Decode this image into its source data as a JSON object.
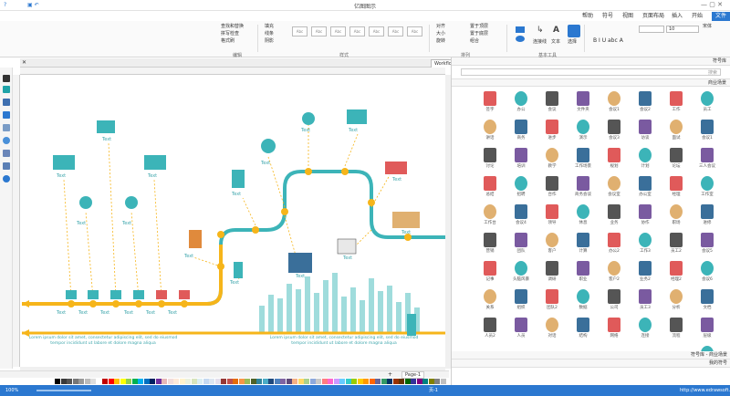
{
  "app": {
    "title": "亿图图示",
    "file_tab": "文件"
  },
  "menu": [
    "开始",
    "插入",
    "页面布局",
    "视图",
    "符号",
    "帮助"
  ],
  "ribbon": {
    "font_name": "宋体",
    "font_size": "10",
    "groups": [
      "文件",
      "基本工具",
      "排列",
      "样式",
      "编辑"
    ],
    "tools": [
      "选择",
      "文本",
      "连接线"
    ],
    "arrange": [
      "置于顶层",
      "置于底层",
      "组合",
      "对齐",
      "大小",
      "旋转"
    ],
    "styles": [
      "Abc",
      "Abc",
      "Abc",
      "Abc",
      "Abc",
      "Abc",
      "Abc",
      "Abc"
    ],
    "edit": [
      "查找和替换",
      "拼写检查",
      "格式刷"
    ],
    "fill": "填充",
    "line": "线条",
    "shadow": "阴影"
  },
  "doc": {
    "tab": "Workflow 4",
    "page_tab": "Page-1",
    "add_page": "+"
  },
  "canvas": {
    "text": "Text",
    "lorem1": "Lorem ipsum dolor sit amet, consectetur adipiscing elit, sed do eiusmod tempor incididunt ut labore et dolore magna aliqua",
    "lorem2": "Lorem ipsum dolor sit amet, consectetur adipiscing elit, sed do eiusmod tempor incididunt ut labore et dolore magna aliqua",
    "bars": [
      30,
      42,
      38,
      54,
      48,
      62,
      44,
      58,
      66,
      40,
      50,
      36,
      60,
      46,
      52,
      34,
      44,
      28
    ]
  },
  "library": {
    "panel_title": "符号库",
    "search_placeholder": "搜索",
    "section": "商业场景",
    "items": [
      "员工",
      "工作",
      "会议2",
      "会议1",
      "文件夹",
      "会议",
      "办公",
      "签字",
      "会议1",
      "面试",
      "访谈",
      "会议3",
      "演示",
      "进步",
      "商务",
      "讲话",
      "三人会议",
      "论坛",
      "计划",
      "规划",
      "工作场景",
      "教学",
      "培训",
      "讨论",
      "工作室",
      "经理",
      "办公室",
      "会议室",
      "商务会谈",
      "合作",
      "招聘",
      "总结",
      "进修",
      "职场",
      "协作",
      "业务",
      "休息",
      "领导",
      "会议4",
      "工作台",
      "会议5",
      "员工2",
      "工作3",
      "办公2",
      "计算",
      "客户",
      "团队",
      "营销",
      "会议6",
      "经理2",
      "业务2",
      "客户2",
      "职业",
      "调研",
      "头脑风暴",
      "记事",
      "文档",
      "分析",
      "员工3",
      "公司",
      "数据",
      "团队2",
      "组织",
      "关系",
      "层级",
      "流程",
      "连接",
      "网络",
      "结构",
      "对话",
      "人员",
      "人员2",
      "图表"
    ],
    "footer": [
      "符号库 - 商业场景",
      "我的符号"
    ]
  },
  "status": {
    "url": "http://www.edrawsoft.cn/",
    "page": "页-1",
    "zoom": "100%"
  },
  "palette": [
    "#000000",
    "#3a3a3a",
    "#555",
    "#777",
    "#999",
    "#bbb",
    "#ddd",
    "#fff",
    "#c00000",
    "#ff0000",
    "#ffc000",
    "#ffff00",
    "#92d050",
    "#00b050",
    "#00b0f0",
    "#0070c0",
    "#002060",
    "#7030a0",
    "#e6b8b7",
    "#f2dcdb",
    "#fde9d9",
    "#fff2cc",
    "#ebf1de",
    "#d8e4bc",
    "#dbeef3",
    "#c5d9f1",
    "#dce6f1",
    "#e4dfec",
    "#953735",
    "#c0504d",
    "#e46c0a",
    "#f79646",
    "#9bbb59",
    "#4f6228",
    "#31859c",
    "#4bacc6",
    "#1f497d",
    "#4f81bd",
    "#8064a2",
    "#604a7b",
    "#f4b084",
    "#ffd966",
    "#a9d08e",
    "#8ea9db",
    "#c9c9c9",
    "#ff7c80",
    "#ff66cc",
    "#cc99ff",
    "#66ccff",
    "#33cccc",
    "#99cc00",
    "#ffcc00",
    "#ff9900",
    "#ff6600",
    "#666699",
    "#339966",
    "#003366",
    "#993300",
    "#663300",
    "#006600",
    "#333399",
    "#800080",
    "#008080",
    "#808000",
    "#808080",
    "#c0c0c0"
  ]
}
